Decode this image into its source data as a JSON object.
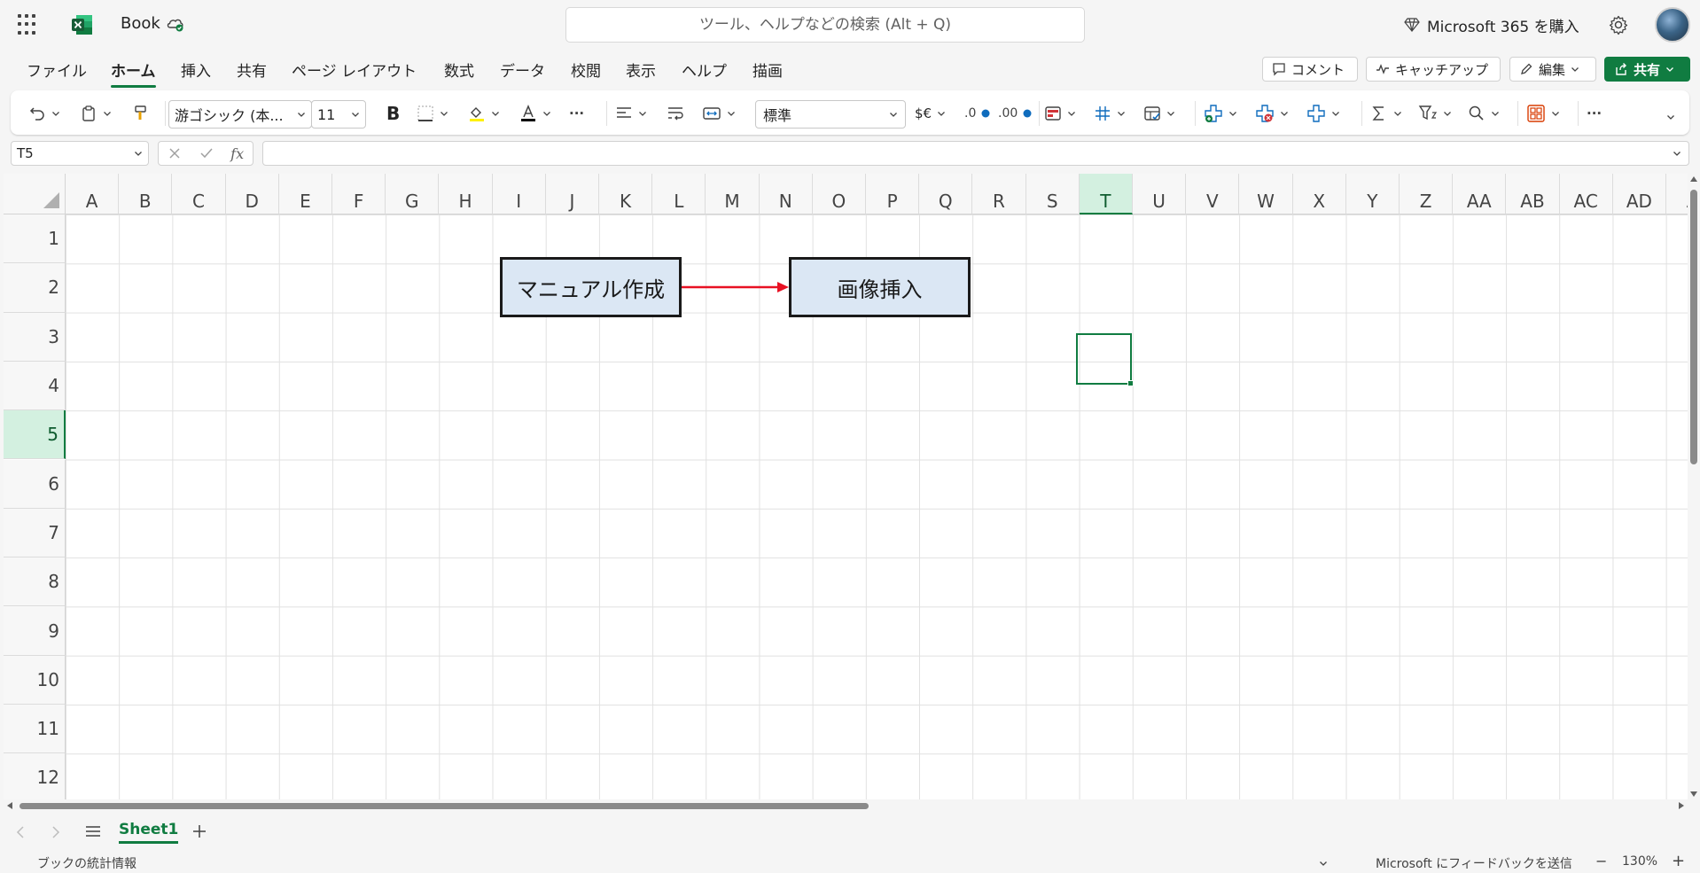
{
  "app": {
    "title": "Book"
  },
  "search": {
    "placeholder": "ツール、ヘルプなどの検索 (Alt + Q)"
  },
  "header": {
    "buy_label": "Microsoft 365 を購入"
  },
  "tabs": [
    {
      "label": "ファイル"
    },
    {
      "label": "ホーム"
    },
    {
      "label": "挿入"
    },
    {
      "label": "共有"
    },
    {
      "label": "ページ レイアウト"
    },
    {
      "label": "数式"
    },
    {
      "label": "データ"
    },
    {
      "label": "校閲"
    },
    {
      "label": "表示"
    },
    {
      "label": "ヘルプ"
    },
    {
      "label": "描画"
    }
  ],
  "actions": {
    "comment": "コメント",
    "catchup": "キャッチアップ",
    "edit": "編集",
    "share": "共有"
  },
  "ribbon": {
    "font_name": "游ゴシック (本...",
    "font_size": "11",
    "bold": "B",
    "number_format": "標準",
    "currency": "$€",
    "dec_decrease": ".0",
    "dec_increase": ".00",
    "more": "···"
  },
  "formula_bar": {
    "name_box": "T5",
    "fx": "fx"
  },
  "grid": {
    "columns": [
      "A",
      "B",
      "C",
      "D",
      "E",
      "F",
      "G",
      "H",
      "I",
      "J",
      "K",
      "L",
      "M",
      "N",
      "O",
      "P",
      "Q",
      "R",
      "S",
      "T",
      "U",
      "V",
      "W",
      "X",
      "Y",
      "Z",
      "AA",
      "AB",
      "AC",
      "AD",
      "A"
    ],
    "rows": [
      "1",
      "2",
      "3",
      "4",
      "5",
      "6",
      "7",
      "8",
      "9",
      "10",
      "11",
      "12"
    ],
    "selected_column": "T",
    "selected_row": "5"
  },
  "shapes": {
    "box1": "マニュアル作成",
    "box2": "画像挿入",
    "arrow_color": "#e81123"
  },
  "sheets": {
    "tab1": "Sheet1"
  },
  "status": {
    "workbook_stats": "ブックの統計情報",
    "feedback": "Microsoft にフィードバックを送信",
    "zoom": "130%",
    "minus": "−",
    "plus": "+"
  },
  "colors": {
    "accent": "#107c41",
    "shape_fill": "#dbe7f4"
  }
}
